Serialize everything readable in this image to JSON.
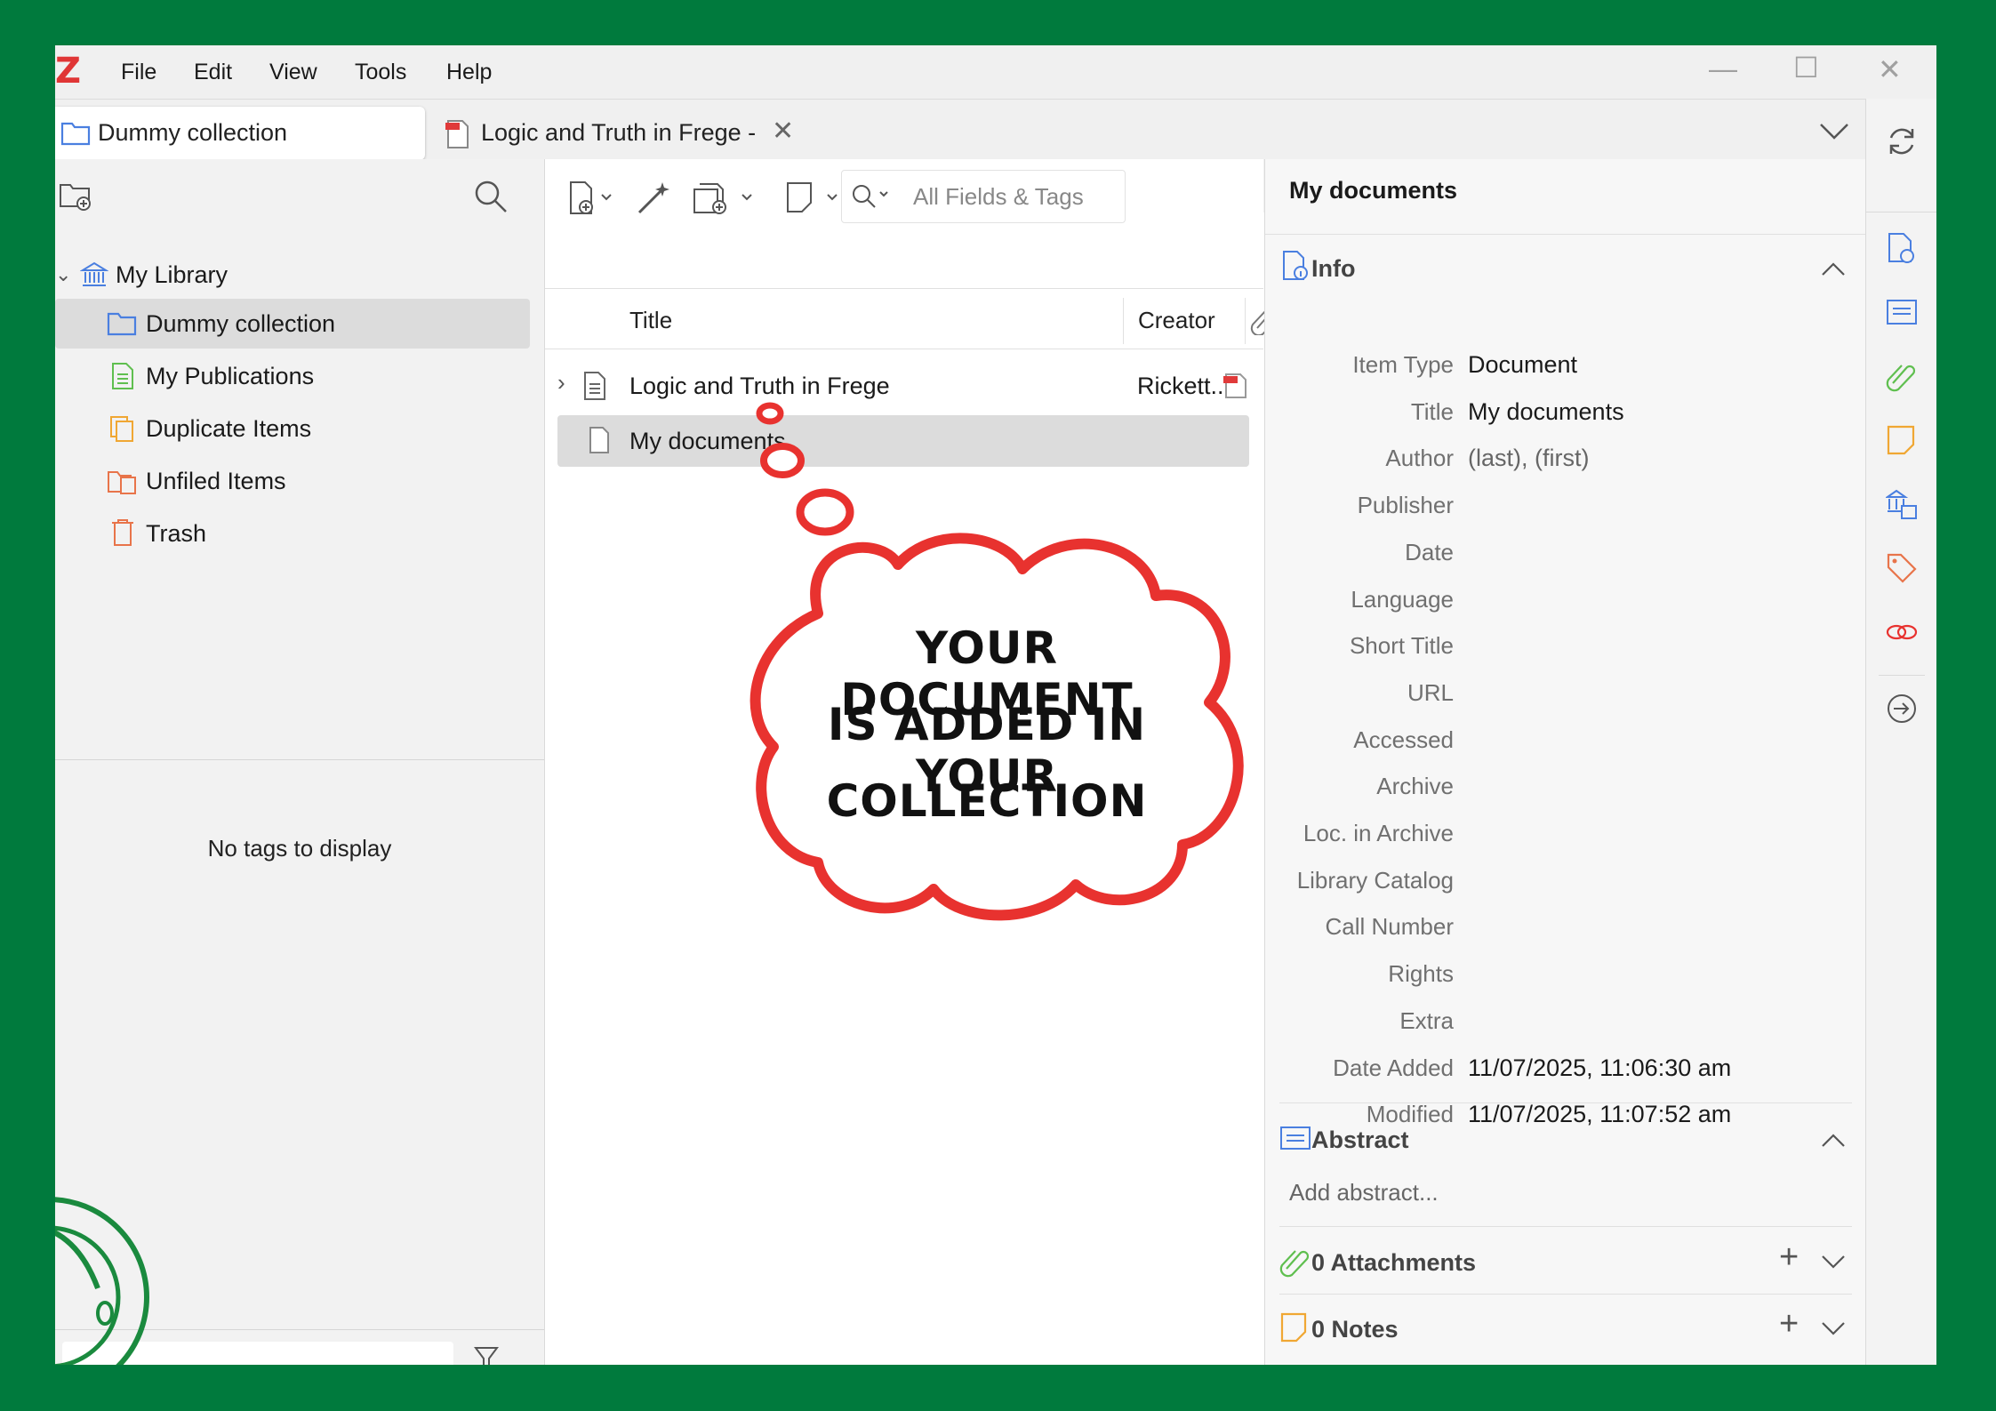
{
  "app": {
    "menu": [
      "File",
      "Edit",
      "View",
      "Tools",
      "Help"
    ]
  },
  "tabs": [
    {
      "label": "Dummy collection"
    },
    {
      "label": "Logic and Truth in Frege -"
    }
  ],
  "library": {
    "root": "My Library",
    "items": [
      {
        "label": "Dummy collection"
      },
      {
        "label": "My Publications"
      },
      {
        "label": "Duplicate Items"
      },
      {
        "label": "Unfiled Items"
      },
      {
        "label": "Trash"
      }
    ],
    "tags_empty": "No tags to display"
  },
  "toolbar": {
    "search_placeholder": "All Fields & Tags"
  },
  "items_table": {
    "columns": [
      "Title",
      "Creator"
    ],
    "rows": [
      {
        "title": "Logic and Truth in Frege",
        "creator": "Rickett..."
      },
      {
        "title": "My documents",
        "creator": ""
      }
    ]
  },
  "item_pane": {
    "header": "My documents",
    "info_title": "Info",
    "fields": [
      {
        "label": "Item Type",
        "value": "Document"
      },
      {
        "label": "Title",
        "value": "My documents"
      },
      {
        "label": "Author",
        "value": "(last), (first)"
      },
      {
        "label": "Publisher",
        "value": ""
      },
      {
        "label": "Date",
        "value": ""
      },
      {
        "label": "Language",
        "value": ""
      },
      {
        "label": "Short Title",
        "value": ""
      },
      {
        "label": "URL",
        "value": ""
      },
      {
        "label": "Accessed",
        "value": ""
      },
      {
        "label": "Archive",
        "value": ""
      },
      {
        "label": "Loc. in Archive",
        "value": ""
      },
      {
        "label": "Library Catalog",
        "value": ""
      },
      {
        "label": "Call Number",
        "value": ""
      },
      {
        "label": "Rights",
        "value": ""
      },
      {
        "label": "Extra",
        "value": ""
      },
      {
        "label": "Date Added",
        "value": "11/07/2025, 11:06:30 am"
      },
      {
        "label": "Modified",
        "value": "11/07/2025, 11:07:52 am"
      }
    ],
    "abstract_title": "Abstract",
    "abstract_placeholder": "Add abstract...",
    "attachments_title": "0 Attachments",
    "notes_title": "0 Notes"
  },
  "callout": {
    "lines": [
      "YOUR DOCUMENT",
      "IS ADDED IN YOUR",
      "COLLECTION"
    ]
  },
  "colors": {
    "background": "#007a3d",
    "accent_red": "#e8322f",
    "zotero_blue": "#4a7fe0",
    "green_icon": "#5fbf4f",
    "orange_icon": "#f0a733"
  }
}
